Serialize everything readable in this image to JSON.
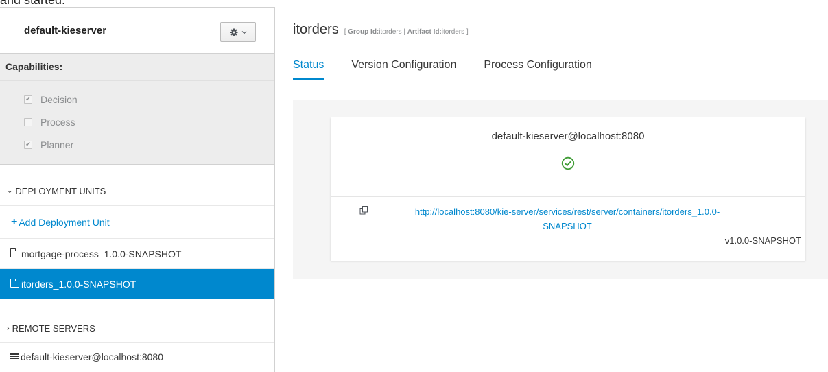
{
  "top_fragment": "and started.",
  "sidebar": {
    "server_name": "default-kieserver",
    "capabilities_title": "Capabilities:",
    "capabilities": [
      {
        "label": "Decision",
        "checked": true
      },
      {
        "label": "Process",
        "checked": false
      },
      {
        "label": "Planner",
        "checked": true
      }
    ],
    "deployment_units_header": "DEPLOYMENT UNITS",
    "add_deployment_unit": "Add Deployment Unit",
    "deployment_units": [
      {
        "label": "mortgage-process_1.0.0-SNAPSHOT",
        "selected": false
      },
      {
        "label": "itorders_1.0.0-SNAPSHOT",
        "selected": true
      }
    ],
    "remote_servers_header": "REMOTE SERVERS",
    "remote_servers": [
      "default-kieserver@localhost:8080"
    ]
  },
  "container": {
    "title": "itorders",
    "meta_open": "[",
    "group_id_label": "Group Id:",
    "group_id": "itorders",
    "separator": "|",
    "artifact_id_label": "Artifact Id:",
    "artifact_id": "itorders",
    "meta_close": "]"
  },
  "tabs": [
    {
      "label": "Status",
      "active": true
    },
    {
      "label": "Version Configuration",
      "active": false
    },
    {
      "label": "Process Configuration",
      "active": false
    }
  ],
  "status_card": {
    "server": "default-kieserver@localhost:8080",
    "status_icon": "check-circle-icon",
    "url_line1": "http://localhost:8080/kie-server/services/rest/server/containers/itorders_1.0.0-",
    "url_line2": "SNAPSHOT",
    "version": "v1.0.0-SNAPSHOT"
  },
  "colors": {
    "accent": "#0088ce",
    "success": "#3f9c35",
    "panel_bg": "#f5f5f5",
    "capabilities_bg": "#ededed"
  }
}
